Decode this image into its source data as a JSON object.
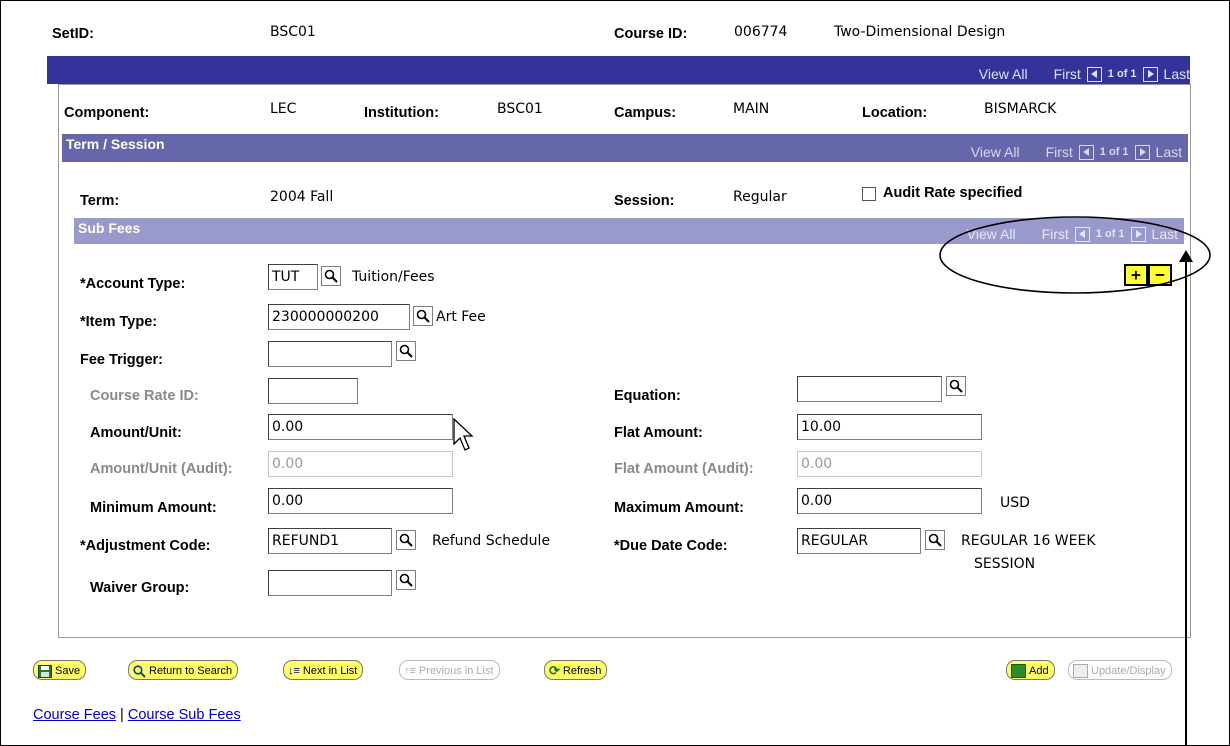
{
  "header": {
    "setid_label": "SetID:",
    "setid_value": "BSC01",
    "course_id_label": "Course ID:",
    "course_id_value": "006774",
    "course_title": "Two-Dimensional Design"
  },
  "top_bar": {
    "view_all": "View All",
    "first": "First",
    "counter": "1 of 1",
    "last": "Last"
  },
  "component_row": {
    "component_label": "Component:",
    "component_value": "LEC",
    "institution_label": "Institution:",
    "institution_value": "BSC01",
    "campus_label": "Campus:",
    "campus_value": "MAIN",
    "location_label": "Location:",
    "location_value": "BISMARCK"
  },
  "term_bar": {
    "title": "Term / Session",
    "view_all": "View All",
    "first": "First",
    "counter": "1 of 1",
    "last": "Last"
  },
  "term_row": {
    "term_label": "Term:",
    "term_value": "2004 Fall",
    "session_label": "Session:",
    "session_value": "Regular",
    "audit_label": "Audit Rate specified"
  },
  "sub_fees_bar": {
    "title": "Sub Fees",
    "view_all": "View All",
    "first": "First",
    "counter": "1 of 1",
    "last": "Last"
  },
  "fields": {
    "account_type_label": "*Account Type:",
    "account_type_value": "TUT",
    "account_type_desc": "Tuition/Fees",
    "item_type_label": "*Item Type:",
    "item_type_value": "230000000200",
    "item_type_desc": "Art Fee",
    "fee_trigger_label": "Fee Trigger:",
    "fee_trigger_value": "",
    "course_rate_id_label": "Course Rate ID:",
    "course_rate_id_value": "",
    "equation_label": "Equation:",
    "equation_value": "",
    "amount_unit_label": "Amount/Unit:",
    "amount_unit_value": "0.00",
    "flat_amount_label": "Flat Amount:",
    "flat_amount_value": "10.00",
    "amount_unit_audit_label": "Amount/Unit (Audit):",
    "amount_unit_audit_value": "0.00",
    "flat_amount_audit_label": "Flat Amount (Audit):",
    "flat_amount_audit_value": "0.00",
    "minimum_amount_label": "Minimum Amount:",
    "minimum_amount_value": "0.00",
    "maximum_amount_label": "Maximum Amount:",
    "maximum_amount_value": "0.00",
    "currency": "USD",
    "adjustment_code_label": "*Adjustment Code:",
    "adjustment_code_value": "REFUND1",
    "adjustment_code_desc": "Refund Schedule",
    "due_date_code_label": "*Due Date Code:",
    "due_date_code_value": "REGULAR",
    "due_date_desc_1": "REGULAR 16 WEEK",
    "due_date_desc_2": "SESSION",
    "waiver_group_label": "Waiver Group:",
    "waiver_group_value": ""
  },
  "row_buttons": {
    "add": "+",
    "delete": "−"
  },
  "toolbar": {
    "save": "Save",
    "return_to_search": "Return to Search",
    "next_in_list": "Next in List",
    "previous_in_list": "Previous in List",
    "refresh": "Refresh",
    "add": "Add",
    "update_display": "Update/Display"
  },
  "footer_links": {
    "course_fees": "Course Fees",
    "separator": "|",
    "course_sub_fees": "Course Sub Fees"
  },
  "colors": {
    "top_bar": "#333399",
    "term_bar": "#6666aa",
    "sub_fees_bar": "#9999cc",
    "button_yellow": "#ffff66",
    "link": "#0000cc"
  }
}
